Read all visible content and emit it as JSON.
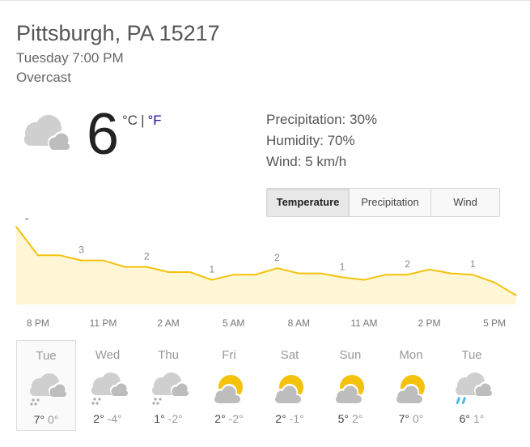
{
  "header": {
    "location": "Pittsburgh, PA 15217",
    "datetime": "Tuesday 7:00 PM",
    "condition": "Overcast"
  },
  "current": {
    "temperature": "6",
    "unit_c": "°C",
    "unit_separator": "|",
    "unit_f": "°F",
    "icon": "cloud-icon"
  },
  "details": {
    "precipitation": "Precipitation: 30%",
    "humidity": "Humidity: 70%",
    "wind": "Wind: 5 km/h"
  },
  "tabs": [
    {
      "label": "Temperature",
      "active": true
    },
    {
      "label": "Precipitation",
      "active": false
    },
    {
      "label": "Wind",
      "active": false
    }
  ],
  "chart_data": {
    "type": "area",
    "title": "",
    "xlabel": "",
    "ylabel": "",
    "x": [
      "7 PM",
      "8 PM",
      "9 PM",
      "10 PM",
      "11 PM",
      "12 AM",
      "1 AM",
      "2 AM",
      "3 AM",
      "4 AM",
      "5 AM",
      "6 AM",
      "7 AM",
      "8 AM",
      "9 AM",
      "10 AM",
      "11 AM",
      "12 PM",
      "1 PM",
      "2 PM",
      "3 PM",
      "4 PM",
      "5 PM",
      "6 PM"
    ],
    "series": [
      {
        "values": [
          6,
          3.8,
          3.8,
          3.4,
          3.4,
          2.9,
          2.9,
          2.5,
          2.5,
          1.9,
          2.3,
          2.3,
          2.8,
          2.4,
          2.4,
          2.1,
          1.9,
          2.3,
          2.3,
          2.7,
          2.4,
          2.3,
          1.7,
          0.7
        ]
      }
    ],
    "data_labels": [
      {
        "x": "7 PM",
        "text": "6"
      },
      {
        "x": "10 PM",
        "text": "3"
      },
      {
        "x": "1 AM",
        "text": "2"
      },
      {
        "x": "4 AM",
        "text": "1"
      },
      {
        "x": "7 AM",
        "text": "2"
      },
      {
        "x": "10 AM",
        "text": "1"
      },
      {
        "x": "1 PM",
        "text": "2"
      },
      {
        "x": "4 PM",
        "text": "1"
      }
    ],
    "tick_labels": [
      {
        "x": "8 PM",
        "text": "8 PM"
      },
      {
        "x": "11 PM",
        "text": "11 PM"
      },
      {
        "x": "2 AM",
        "text": "2 AM"
      },
      {
        "x": "5 AM",
        "text": "5 AM"
      },
      {
        "x": "8 AM",
        "text": "8 AM"
      },
      {
        "x": "11 AM",
        "text": "11 AM"
      },
      {
        "x": "2 PM",
        "text": "2 PM"
      },
      {
        "x": "5 PM",
        "text": "5 PM"
      }
    ],
    "ylim": [
      0,
      7
    ],
    "grid": false,
    "line_color": "#f4c20d",
    "fill_color": "#fff6d5"
  },
  "forecast": [
    {
      "day": "Tue",
      "hi": "7°",
      "lo": "0°",
      "icon": "cloud-snow-icon",
      "selected": true
    },
    {
      "day": "Wed",
      "hi": "2°",
      "lo": "-4°",
      "icon": "cloud-snow-icon",
      "selected": false
    },
    {
      "day": "Thu",
      "hi": "1°",
      "lo": "-2°",
      "icon": "cloud-snow-icon",
      "selected": false
    },
    {
      "day": "Fri",
      "hi": "2°",
      "lo": "-2°",
      "icon": "partly-cloudy-icon",
      "selected": false
    },
    {
      "day": "Sat",
      "hi": "2°",
      "lo": "-1°",
      "icon": "partly-cloudy-icon",
      "selected": false
    },
    {
      "day": "Sun",
      "hi": "5°",
      "lo": "2°",
      "icon": "partly-cloudy-icon",
      "selected": false
    },
    {
      "day": "Mon",
      "hi": "7°",
      "lo": "0°",
      "icon": "partly-cloudy-icon",
      "selected": false
    },
    {
      "day": "Tue",
      "hi": "6°",
      "lo": "1°",
      "icon": "cloud-rain-icon",
      "selected": false
    }
  ],
  "colors": {
    "sun": "#f4c20d",
    "cloud": "#cfcfcf",
    "rain": "#4db6e8",
    "link": "#1a0dab"
  }
}
